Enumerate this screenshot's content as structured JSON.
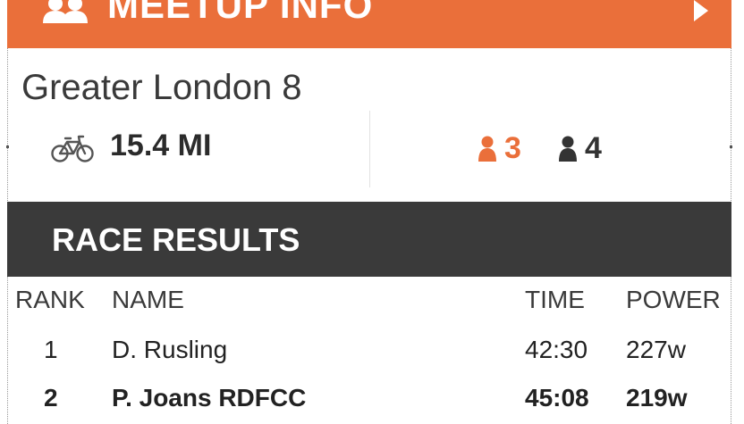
{
  "header": {
    "title": "MEETUP INFO",
    "accent": "#ea6f3a",
    "icons": [
      "people-icon",
      "play-arrow-icon"
    ]
  },
  "meetup": {
    "name": "Greater London 8",
    "distance": "15.4 MI",
    "riders": [
      {
        "icon": "rider-icon",
        "count": "3",
        "color": "#ea6f3a"
      },
      {
        "icon": "rider-icon",
        "count": "4",
        "color": "#333333"
      }
    ]
  },
  "results": {
    "title": "RACE RESULTS",
    "band_color": "#3a3a3a",
    "columns": {
      "rank": "RANK",
      "name": "NAME",
      "time": "TIME",
      "power": "POWER"
    },
    "rows": [
      {
        "rank": "1",
        "name": "D. Rusling",
        "time": "42:30",
        "power": "227w",
        "bold": false
      },
      {
        "rank": "2",
        "name": "P. Joans RDFCC",
        "time": "45:08",
        "power": "219w",
        "bold": true
      }
    ]
  }
}
